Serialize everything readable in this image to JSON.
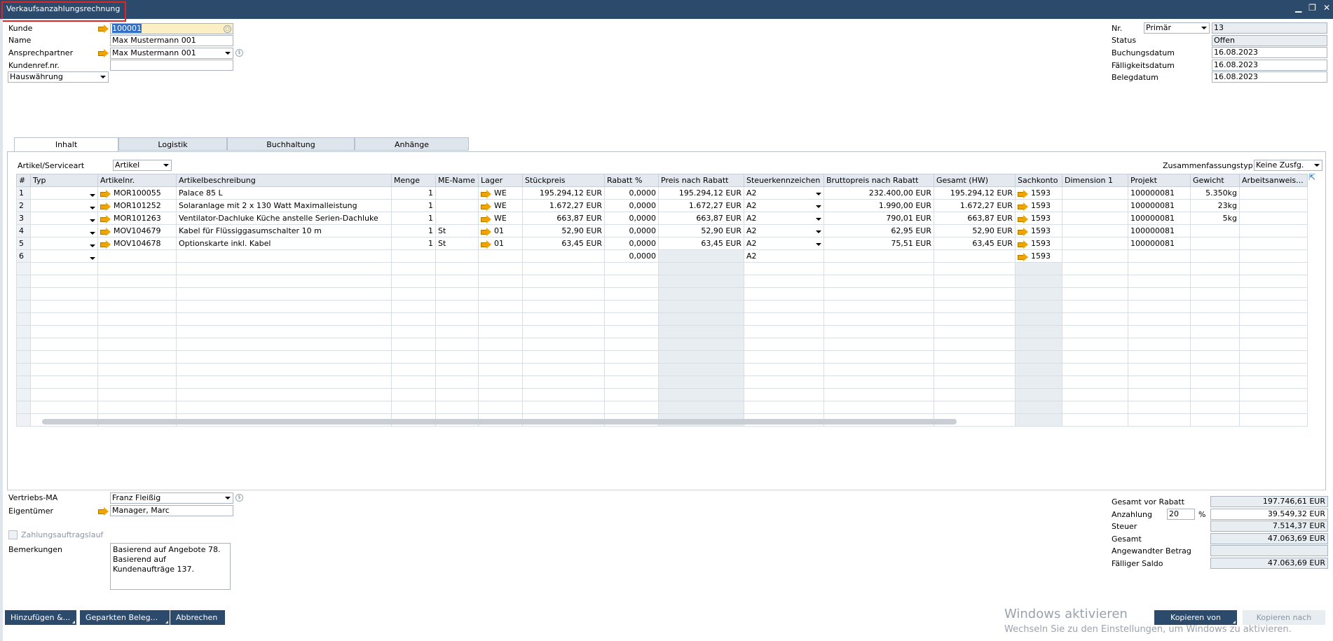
{
  "window": {
    "title": "Verkaufsanzahlungsrechnung",
    "minimize": "▁",
    "restore": "❐",
    "close": "✕"
  },
  "header_left": {
    "kunde_label": "Kunde",
    "kunde_value": "100001",
    "name_label": "Name",
    "name_value": "Max Mustermann 001",
    "ansprechpartner_label": "Ansprechpartner",
    "ansprechpartner_value": "Max Mustermann 001",
    "kundenref_label": "Kundenref.nr.",
    "kundenref_value": "",
    "waehrung_value": "Hauswährung"
  },
  "header_right": {
    "nr_label": "Nr.",
    "nr_series": "Primär",
    "nr_value": "13",
    "status_label": "Status",
    "status_value": "Offen",
    "buchungsdatum_label": "Buchungsdatum",
    "buchungsdatum_value": "16.08.2023",
    "faelligkeitsdatum_label": "Fälligkeitsdatum",
    "faelligkeitsdatum_value": "16.08.2023",
    "belegdatum_label": "Belegdatum",
    "belegdatum_value": "16.08.2023"
  },
  "tabs": [
    "Inhalt",
    "Logistik",
    "Buchhaltung",
    "Anhänge"
  ],
  "content": {
    "artikelart_label": "Artikel/Serviceart",
    "artikelart_value": "Artikel",
    "zusammenfassung_label": "Zusammenfassungstyp",
    "zusammenfassung_value": "Keine Zusfg."
  },
  "grid": {
    "columns": [
      "#",
      "Typ",
      "Artikelnr.",
      "Artikelbeschreibung",
      "Menge",
      "ME-Name",
      "Lager",
      "Stückpreis",
      "Rabatt %",
      "Preis nach Rabatt",
      "Steuerkennzeichen",
      "Bruttopreis nach Rabatt",
      "Gesamt (HW)",
      "Sachkonto",
      "Dimension 1",
      "Projekt",
      "Gewicht",
      "Arbeitsanweis..."
    ],
    "rows": [
      {
        "nr": "1",
        "artikelnr": "MOR100055",
        "beschreibung": "Palace 85 L",
        "menge": "1",
        "me": "",
        "lager": "WE",
        "stueckpreis": "195.294,12 EUR",
        "rabatt": "0,0000",
        "preis_rabatt": "195.294,12 EUR",
        "steuer": "A2",
        "brutto": "232.400,00 EUR",
        "gesamt": "195.294,12 EUR",
        "sachkonto": "1593",
        "dimension": "",
        "projekt": "100000081",
        "gewicht": "5.350kg",
        "arbeit": ""
      },
      {
        "nr": "2",
        "artikelnr": "MOR101252",
        "beschreibung": "Solaranlage mit 2 x 130 Watt Maximalleistung",
        "menge": "1",
        "me": "",
        "lager": "WE",
        "stueckpreis": "1.672,27 EUR",
        "rabatt": "0,0000",
        "preis_rabatt": "1.672,27 EUR",
        "steuer": "A2",
        "brutto": "1.990,00 EUR",
        "gesamt": "1.672,27 EUR",
        "sachkonto": "1593",
        "dimension": "",
        "projekt": "100000081",
        "gewicht": "23kg",
        "arbeit": ""
      },
      {
        "nr": "3",
        "artikelnr": "MOR101263",
        "beschreibung": "Ventilator-Dachluke Küche anstelle Serien-Dachluke",
        "menge": "1",
        "me": "",
        "lager": "WE",
        "stueckpreis": "663,87 EUR",
        "rabatt": "0,0000",
        "preis_rabatt": "663,87 EUR",
        "steuer": "A2",
        "brutto": "790,01 EUR",
        "gesamt": "663,87 EUR",
        "sachkonto": "1593",
        "dimension": "",
        "projekt": "100000081",
        "gewicht": "5kg",
        "arbeit": ""
      },
      {
        "nr": "4",
        "artikelnr": "MOV104679",
        "beschreibung": "Kabel für Flüssiggasumschalter 10 m",
        "menge": "1",
        "me": "St",
        "lager": "01",
        "stueckpreis": "52,90 EUR",
        "rabatt": "0,0000",
        "preis_rabatt": "52,90 EUR",
        "steuer": "A2",
        "brutto": "62,95 EUR",
        "gesamt": "52,90 EUR",
        "sachkonto": "1593",
        "dimension": "",
        "projekt": "100000081",
        "gewicht": "",
        "arbeit": ""
      },
      {
        "nr": "5",
        "artikelnr": "MOV104678",
        "beschreibung": "Optionskarte inkl. Kabel",
        "menge": "1",
        "me": "St",
        "lager": "01",
        "stueckpreis": "63,45 EUR",
        "rabatt": "0,0000",
        "preis_rabatt": "63,45 EUR",
        "steuer": "A2",
        "brutto": "75,51 EUR",
        "gesamt": "63,45 EUR",
        "sachkonto": "1593",
        "dimension": "",
        "projekt": "100000081",
        "gewicht": "",
        "arbeit": ""
      },
      {
        "nr": "6",
        "artikelnr": "",
        "beschreibung": "",
        "menge": "",
        "me": "",
        "lager": "",
        "stueckpreis": "",
        "rabatt": "0,0000",
        "preis_rabatt": "",
        "steuer": "A2",
        "brutto": "",
        "gesamt": "",
        "sachkonto": "1593",
        "dimension": "",
        "projekt": "",
        "gewicht": "",
        "arbeit": ""
      }
    ]
  },
  "footer_left": {
    "vertriebs_label": "Vertriebs-MA",
    "vertriebs_value": "Franz Fleißig",
    "eigentuemer_label": "Eigentümer",
    "eigentuemer_value": "Manager, Marc",
    "zahlungsauftrag_label": "Zahlungsauftragslauf",
    "bemerkungen_label": "Bemerkungen",
    "bemerkungen_value": "Basierend auf Angebote 78.\nBasierend auf Kundenaufträge 137."
  },
  "totals": {
    "gesamt_vor_rabatt_label": "Gesamt vor Rabatt",
    "gesamt_vor_rabatt_value": "197.746,61 EUR",
    "anzahlung_label": "Anzahlung",
    "anzahlung_percent": "20",
    "percent_sign": "%",
    "anzahlung_value": "39.549,32 EUR",
    "steuer_label": "Steuer",
    "steuer_value": "7.514,37 EUR",
    "gesamt_label": "Gesamt",
    "gesamt_value": "47.063,69 EUR",
    "angewandt_label": "Angewandter Betrag",
    "angewandt_value": "",
    "faelliger_label": "Fälliger Saldo",
    "faelliger_value": "47.063,69 EUR"
  },
  "buttons": {
    "hinzufuegen": "Hinzufügen &...",
    "geparkt": "Geparkten Beleg...",
    "abbrechen": "Abbrechen",
    "kopieren_von": "Kopieren von",
    "kopieren_nach": "Kopieren nach"
  },
  "watermark": {
    "line1": "Windows aktivieren",
    "line2": "Wechseln Sie zu den Einstellungen, um Windows zu aktivieren."
  },
  "colors": {
    "titlebar": "#2c4a6b",
    "highlight": "#e32222",
    "arrow": "#f0a400",
    "button": "#2c4a6b"
  }
}
